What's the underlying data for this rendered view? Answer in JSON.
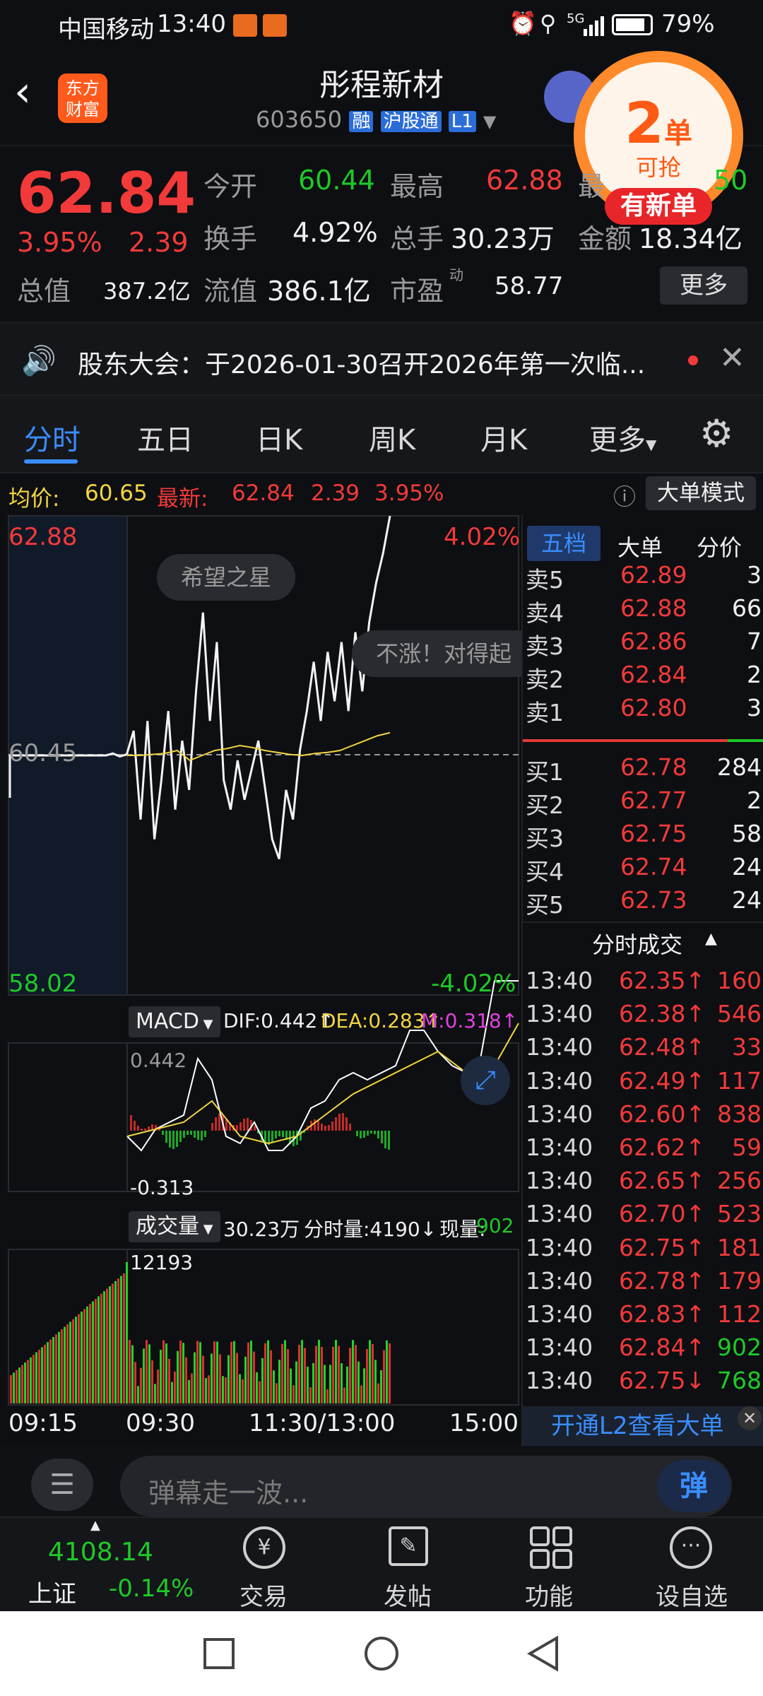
{
  "status": {
    "carrier": "中国移动",
    "time": "13:40",
    "battery": "79%",
    "signal": "5G"
  },
  "header": {
    "logo_line1": "东方",
    "logo_line2": "财富",
    "stock_name": "彤程新材",
    "stock_code": "603650",
    "badge_rong": "融",
    "badge_hgt": "沪股通",
    "badge_level": "L1"
  },
  "promo": {
    "count": "2",
    "unit": "单",
    "sub": "可抢",
    "banner": "有新单"
  },
  "quote": {
    "price": "62.84",
    "change_pct": "3.95%",
    "change": "2.39",
    "open_label": "今开",
    "open": "60.44",
    "high_label": "最高",
    "high": "62.88",
    "low_label": "最",
    "low": "50",
    "turnover_label": "换手",
    "turnover": "4.92%",
    "volume_label": "总手",
    "volume": "30.23万",
    "amount_label": "金额",
    "amount": "18.34亿",
    "mktcap_label": "总值",
    "mktcap": "387.2亿",
    "float_label": "流值",
    "float_cap": "386.1亿",
    "pe_label": "市盈",
    "pe_sup": "动",
    "pe": "58.77",
    "more_btn": "更多"
  },
  "notice": {
    "text": "股东大会：于2026-01-30召开2026年第一次临..."
  },
  "tabs": [
    "分时",
    "五日",
    "日K",
    "周K",
    "月K",
    "更多"
  ],
  "infobar": {
    "avg_label": "均价:",
    "avg": "60.65",
    "latest_label": "最新:",
    "latest": "62.84",
    "chg": "2.39",
    "pct": "3.95%",
    "mode_btn": "大单模式"
  },
  "chart": {
    "y_top": "62.88",
    "y_mid": "60.45",
    "y_bot": "58.02",
    "pct_top": "4.02%",
    "pct_bot": "-4.02%",
    "bubble1": "希望之星",
    "bubble2": "不涨！对得起",
    "macd_btn": "MACD",
    "dif": "DIF:0.442↑",
    "dea": "DEA:0.283↑",
    "m": "M:0.318↑",
    "macd_top": "0.442",
    "macd_bot": "-0.313",
    "vol_btn": "成交量",
    "vol_total": "30.23万",
    "vol_period": "分时量:4190↓",
    "vol_now_label": "现量:",
    "vol_now": "902",
    "vol_max": "12193",
    "x_labels": [
      "09:15",
      "09:30",
      "11:30/13:00",
      "15:00"
    ]
  },
  "chart_data": {
    "type": "line",
    "y_range": [
      58.02,
      62.88
    ],
    "prev_close": 60.45,
    "price": [
      60.45,
      60.47,
      60.44,
      60.46,
      60.7,
      59.8,
      60.8,
      59.6,
      60.2,
      60.9,
      59.9,
      60.6,
      60.1,
      61.1,
      61.9,
      60.8,
      61.6,
      60.2,
      59.9,
      60.4,
      60.0,
      60.3,
      60.6,
      60.1,
      59.6,
      59.4,
      60.1,
      59.8,
      60.5,
      60.9,
      61.4,
      60.8,
      61.5,
      61.0,
      61.6,
      60.9,
      61.7,
      61.1,
      61.8,
      62.2,
      62.5,
      62.88
    ],
    "avg": [
      60.45,
      60.45,
      60.46,
      60.47,
      60.5,
      60.4,
      60.45,
      60.5,
      60.52,
      60.55,
      60.53,
      60.5,
      60.48,
      60.46,
      60.45,
      60.47,
      60.48,
      60.5,
      60.55,
      60.6,
      60.65,
      60.68
    ]
  },
  "orderbook": {
    "tabs": [
      "五档",
      "大单",
      "分价"
    ],
    "asks": [
      {
        "label": "卖5",
        "price": "62.89",
        "vol": "3"
      },
      {
        "label": "卖4",
        "price": "62.88",
        "vol": "66"
      },
      {
        "label": "卖3",
        "price": "62.86",
        "vol": "7"
      },
      {
        "label": "卖2",
        "price": "62.84",
        "vol": "2"
      },
      {
        "label": "卖1",
        "price": "62.80",
        "vol": "3"
      }
    ],
    "bids": [
      {
        "label": "买1",
        "price": "62.78",
        "vol": "284"
      },
      {
        "label": "买2",
        "price": "62.77",
        "vol": "2"
      },
      {
        "label": "买3",
        "price": "62.75",
        "vol": "58"
      },
      {
        "label": "买4",
        "price": "62.74",
        "vol": "24"
      },
      {
        "label": "买5",
        "price": "62.73",
        "vol": "24"
      }
    ],
    "ticks_title": "分时成交",
    "ticks": [
      {
        "t": "13:40",
        "p": "62.35↑",
        "v": "160",
        "c": "red"
      },
      {
        "t": "13:40",
        "p": "62.38↑",
        "v": "546",
        "c": "red"
      },
      {
        "t": "13:40",
        "p": "62.48↑",
        "v": "33",
        "c": "red"
      },
      {
        "t": "13:40",
        "p": "62.49↑",
        "v": "117",
        "c": "red"
      },
      {
        "t": "13:40",
        "p": "62.60↑",
        "v": "838",
        "c": "red"
      },
      {
        "t": "13:40",
        "p": "62.62↑",
        "v": "59",
        "c": "red"
      },
      {
        "t": "13:40",
        "p": "62.65↑",
        "v": "256",
        "c": "red"
      },
      {
        "t": "13:40",
        "p": "62.70↑",
        "v": "523",
        "c": "red"
      },
      {
        "t": "13:40",
        "p": "62.75↑",
        "v": "181",
        "c": "red"
      },
      {
        "t": "13:40",
        "p": "62.78↑",
        "v": "179",
        "c": "red"
      },
      {
        "t": "13:40",
        "p": "62.83↑",
        "v": "112",
        "c": "red"
      },
      {
        "t": "13:40",
        "p": "62.84↑",
        "v": "902",
        "c": "green"
      },
      {
        "t": "13:40",
        "p": "62.75↓",
        "v": "768",
        "c": "green"
      }
    ],
    "l2_link": "开通L2查看大单"
  },
  "danmu": {
    "placeholder": "弹幕走一波...",
    "btn": "弹"
  },
  "bottomnav": {
    "index_value": "4108.14",
    "index_name": "上证",
    "index_pct": "-0.14%",
    "items": [
      "交易",
      "发帖",
      "功能",
      "设自选"
    ]
  }
}
